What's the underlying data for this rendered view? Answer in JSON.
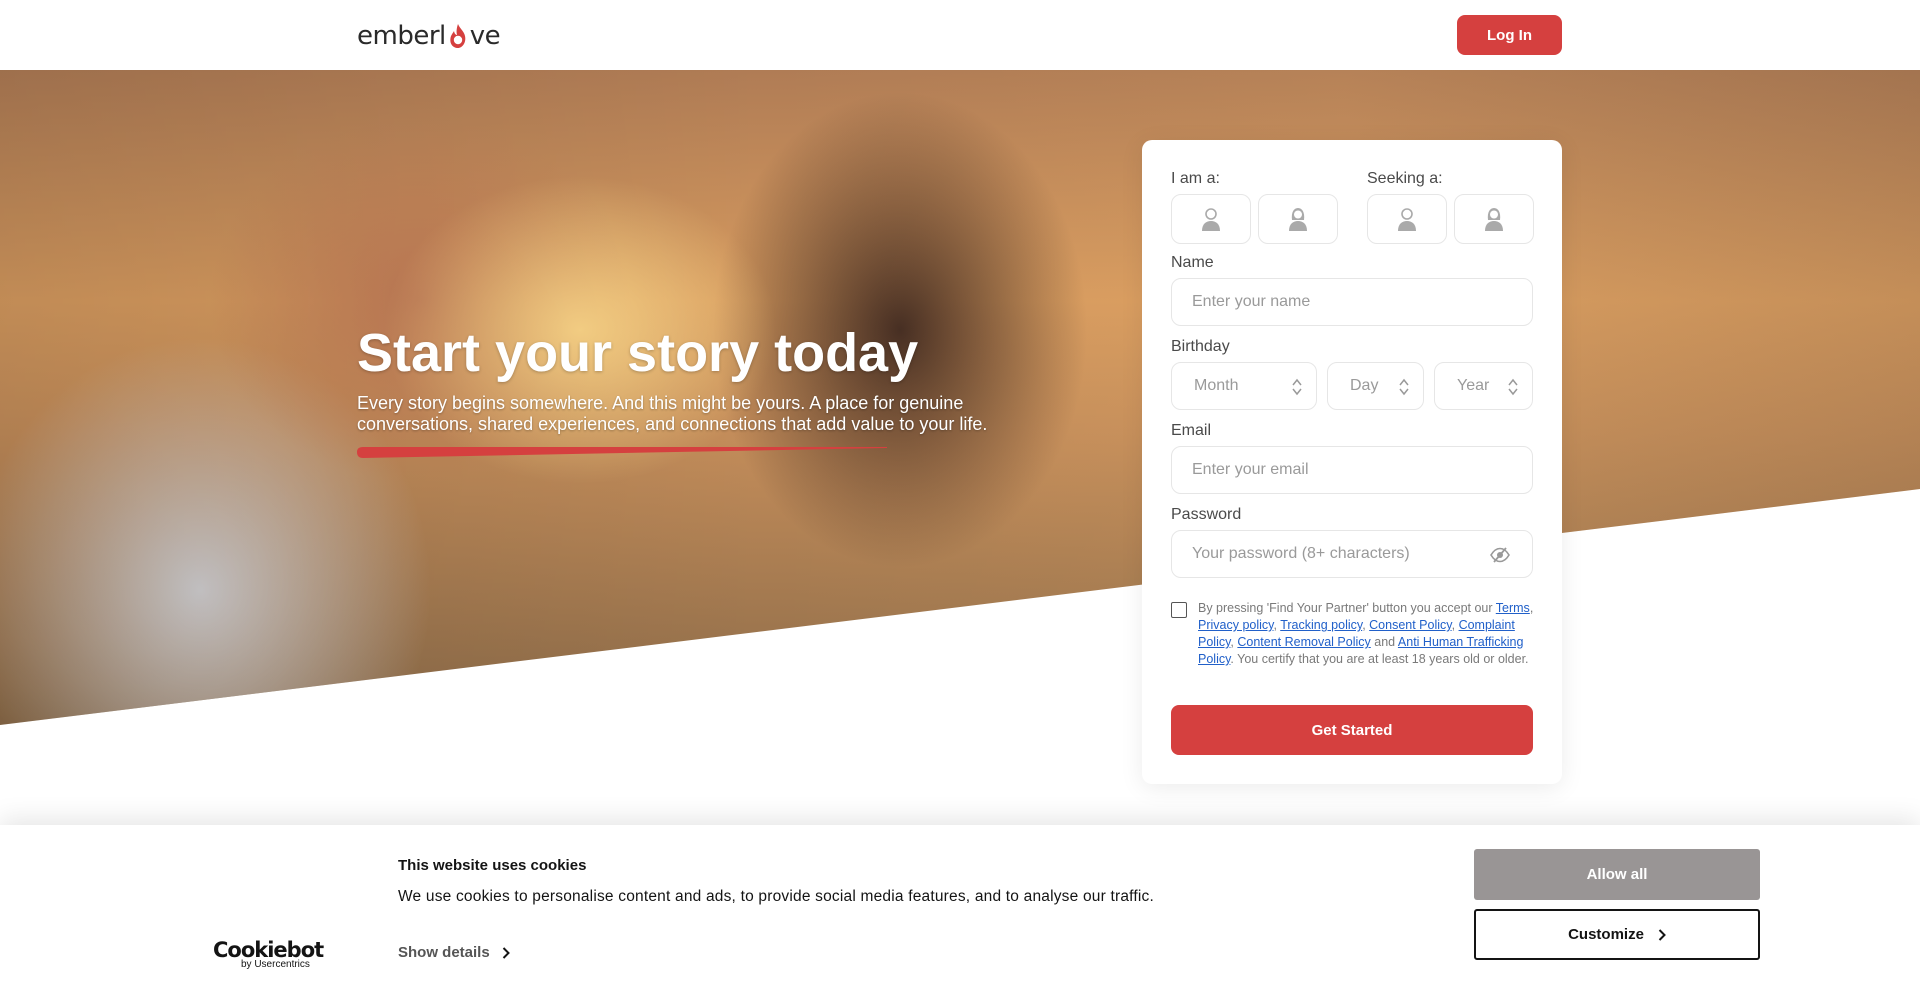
{
  "header": {
    "logo_prefix": "emberl",
    "logo_suffix": "ve",
    "login_label": "Log In"
  },
  "hero": {
    "title": "Start your story today",
    "subtitle": "Every story begins somewhere. And this might be yours. A place for genuine conversations, shared experiences, and connections that add value to your life."
  },
  "form": {
    "i_am_label": "I am a:",
    "seeking_label": "Seeking a:",
    "gender_icons": [
      "male-icon",
      "female-icon"
    ],
    "name_label": "Name",
    "name_placeholder": "Enter your name",
    "birthday_label": "Birthday",
    "month_placeholder": "Month",
    "day_placeholder": "Day",
    "year_placeholder": "Year",
    "email_label": "Email",
    "email_placeholder": "Enter your email",
    "password_label": "Password",
    "password_placeholder": "Your password (8+ characters)",
    "terms": {
      "intro": "By pressing 'Find Your Partner' button you accept our",
      "terms_link": "Terms",
      "privacy_link": "Privacy policy",
      "tracking_link": "Tracking policy",
      "consent_link": "Consent Policy",
      "complaint_link": "Complaint Policy",
      "content_removal_link": "Content Removal Policy",
      "and": "and",
      "anti_trafficking_link": "Anti Human Trafficking Policy",
      "outro": ". You certify that you are at least 18 years old or older."
    },
    "submit_label": "Get Started"
  },
  "cookie_banner": {
    "brand": "Cookiebot",
    "brand_by": "by Usercentrics",
    "title": "This website uses cookies",
    "text": "We use cookies to personalise content and ads, to provide social media features, and to analyse our traffic.",
    "details_label": "Show details",
    "allow_label": "Allow all",
    "customize_label": "Customize"
  },
  "colors": {
    "accent": "#d5403f",
    "link": "#2160c9",
    "allow_button": "#999595"
  }
}
